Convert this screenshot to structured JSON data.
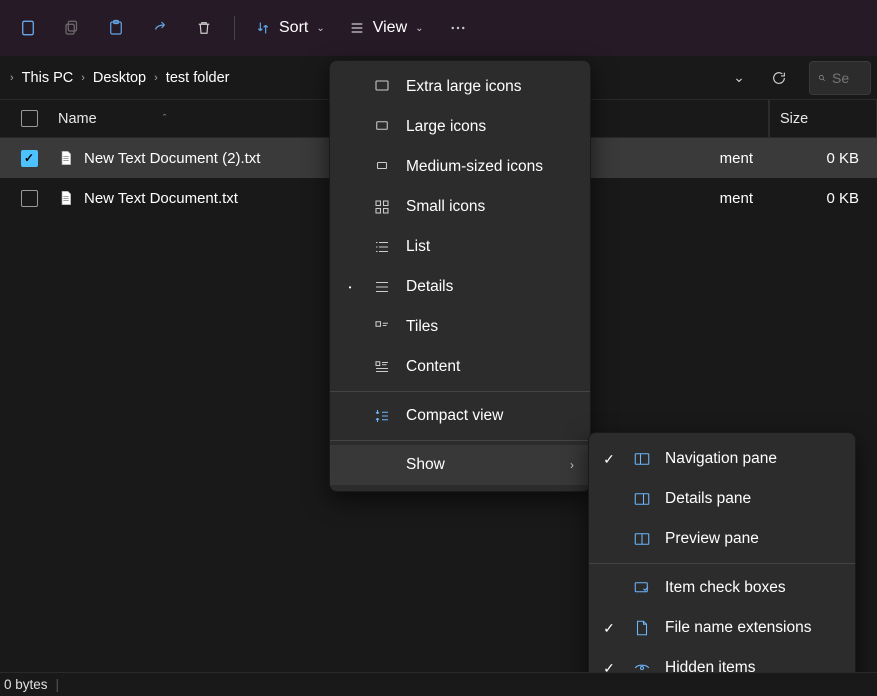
{
  "toolbar": {
    "sort_label": "Sort",
    "view_label": "View"
  },
  "breadcrumbs": [
    "This PC",
    "Desktop",
    "test folder"
  ],
  "search_placeholder": "Se",
  "columns": {
    "name": "Name",
    "size": "Size"
  },
  "files": [
    {
      "name": "New Text Document (2).txt",
      "type_tail": "ment",
      "size": "0 KB",
      "selected": true
    },
    {
      "name": "New Text Document.txt",
      "type_tail": "ment",
      "size": "0 KB",
      "selected": false
    }
  ],
  "view_menu": {
    "items": [
      {
        "label": "Extra large icons",
        "icon": "xl"
      },
      {
        "label": "Large icons",
        "icon": "l"
      },
      {
        "label": "Medium-sized icons",
        "icon": "m"
      },
      {
        "label": "Small icons",
        "icon": "s"
      },
      {
        "label": "List",
        "icon": "list"
      },
      {
        "label": "Details",
        "icon": "details",
        "current": true
      },
      {
        "label": "Tiles",
        "icon": "tiles"
      },
      {
        "label": "Content",
        "icon": "content"
      }
    ],
    "compact": "Compact view",
    "show": "Show"
  },
  "show_menu": [
    {
      "label": "Navigation pane",
      "checked": true,
      "icon": "nav"
    },
    {
      "label": "Details pane",
      "checked": false,
      "icon": "details"
    },
    {
      "label": "Preview pane",
      "checked": false,
      "icon": "preview"
    },
    {
      "label": "Item check boxes",
      "checked": false,
      "icon": "checkbox"
    },
    {
      "label": "File name extensions",
      "checked": true,
      "icon": "ext"
    },
    {
      "label": "Hidden items",
      "checked": true,
      "icon": "hidden"
    }
  ],
  "status_text": "0 bytes"
}
